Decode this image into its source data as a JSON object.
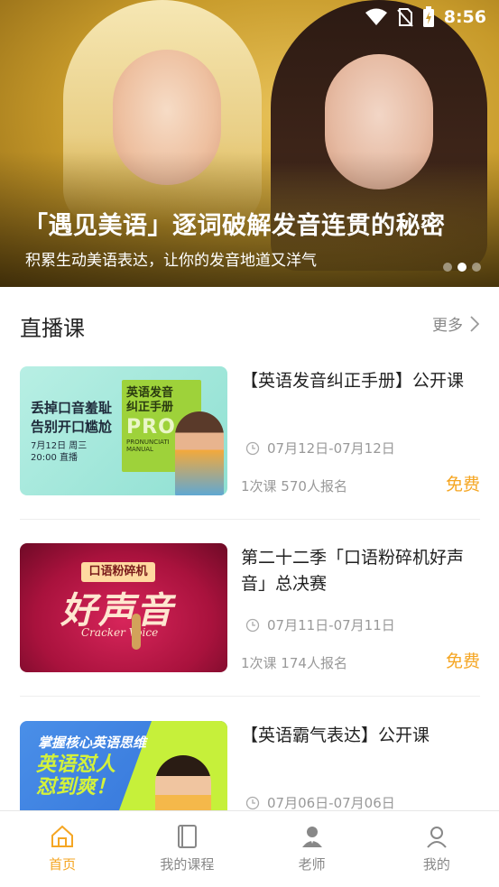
{
  "status_bar": {
    "time": "8:56"
  },
  "banner": {
    "title": "「遇见美语」逐词破解发音连贯的秘密",
    "subtitle": "积累生动美语表达，让你的发音地道又洋气",
    "page_count": 3,
    "active_page": 2
  },
  "section": {
    "title": "直播课",
    "more_label": "更多"
  },
  "courses": [
    {
      "title": "【英语发音纠正手册】公开课",
      "date": "07月12日-07月12日",
      "meta": "1次课  570人报名",
      "price": "免费",
      "thumb": {
        "line1": "丢掉口音羞耻",
        "line2": "告别开口尴尬",
        "line3": "7月12日 周三",
        "line4": "20:00 直播",
        "book1": "英语发音",
        "book2": "纠正手册",
        "book3": "PRO",
        "book4": "PRONUNCIATI",
        "book5": "MANUAL"
      }
    },
    {
      "title": "第二十二季「口语粉碎机好声音」总决赛",
      "date": "07月11日-07月11日",
      "meta": "1次课  174人报名",
      "price": "免费",
      "thumb": {
        "badge": "口语粉碎机",
        "big": "好声音",
        "script": "Cracker Voice"
      }
    },
    {
      "title": "【英语霸气表达】公开课",
      "date": "07月06日-07月06日",
      "meta": "",
      "price": "",
      "thumb": {
        "line1": "掌握核心英语思维",
        "line2": "英语怼人",
        "line3": "怼到爽！"
      }
    }
  ],
  "tabs": [
    {
      "label": "首页",
      "icon": "home-icon",
      "active": true
    },
    {
      "label": "我的课程",
      "icon": "book-icon",
      "active": false
    },
    {
      "label": "老师",
      "icon": "teacher-icon",
      "active": false
    },
    {
      "label": "我的",
      "icon": "user-icon",
      "active": false
    }
  ],
  "colors": {
    "accent": "#f5a623",
    "muted": "#999999"
  }
}
